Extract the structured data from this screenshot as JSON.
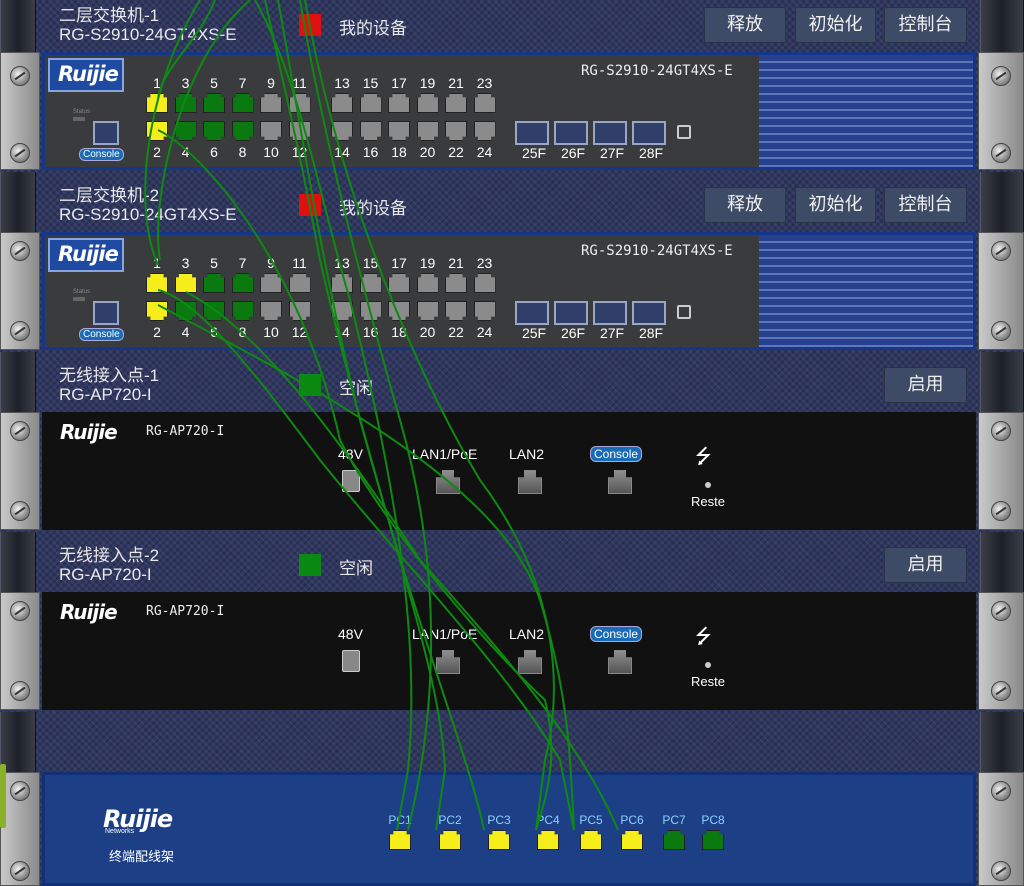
{
  "devices": [
    {
      "name": "二层交换机-1",
      "model": "RG-S2910-24GT4XS-E",
      "status_text": "我的设备",
      "status_color": "#e01010",
      "buttons": [
        "释放",
        "初始化",
        "控制台"
      ]
    },
    {
      "name": "二层交换机-2",
      "model": "RG-S2910-24GT4XS-E",
      "status_text": "我的设备",
      "status_color": "#e01010",
      "buttons": [
        "释放",
        "初始化",
        "控制台"
      ]
    },
    {
      "name": "无线接入点-1",
      "model": "RG-AP720-I",
      "status_text": "空闲",
      "status_color": "#0a8a12",
      "buttons": [
        "启用"
      ]
    },
    {
      "name": "无线接入点-2",
      "model": "RG-AP720-I",
      "status_text": "空闲",
      "status_color": "#0a8a12",
      "buttons": [
        "启用"
      ]
    }
  ],
  "switch_panel": {
    "logo": "Ruijie",
    "model_label": "RG-S2910-24GT4XS-E",
    "top_numbers": [
      "1",
      "3",
      "5",
      "7",
      "9",
      "11",
      "13",
      "15",
      "17",
      "19",
      "21",
      "23"
    ],
    "bottom_numbers": [
      "2",
      "4",
      "6",
      "8",
      "10",
      "12",
      "14",
      "16",
      "18",
      "20",
      "22",
      "24"
    ],
    "sfp_labels": [
      "25F",
      "26F",
      "27F",
      "28F"
    ],
    "console": "Console",
    "status_led": "Status",
    "port_colors": [
      {
        "top": [
          "yellow",
          "green",
          "green",
          "green",
          "gray",
          "gray",
          "gray",
          "gray",
          "gray",
          "gray",
          "gray",
          "gray"
        ],
        "bottom": [
          "yellow",
          "green",
          "green",
          "green",
          "gray",
          "gray",
          "gray",
          "gray",
          "gray",
          "gray",
          "gray",
          "gray"
        ]
      },
      {
        "top": [
          "yellow",
          "yellow",
          "green",
          "green",
          "gray",
          "gray",
          "gray",
          "gray",
          "gray",
          "gray",
          "gray",
          "gray"
        ],
        "bottom": [
          "yellow",
          "green",
          "green",
          "green",
          "gray",
          "gray",
          "gray",
          "gray",
          "gray",
          "gray",
          "gray",
          "gray"
        ]
      }
    ]
  },
  "ap_panel": {
    "logo": "Ruijie",
    "model_label": "RG-AP720-I",
    "labels": {
      "power": "48V",
      "lan1": "LAN1/PoE",
      "lan2": "LAN2",
      "console": "Console",
      "reset": "Reste"
    },
    "usb_icon": "usb-icon"
  },
  "patch_panel": {
    "logo": "Ruijie",
    "logo_sub": "Networks",
    "caption": "终端配线架",
    "ports": [
      {
        "label": "PC1",
        "color": "yellow"
      },
      {
        "label": "PC2",
        "color": "yellow"
      },
      {
        "label": "PC3",
        "color": "yellow"
      },
      {
        "label": "PC4",
        "color": "yellow"
      },
      {
        "label": "PC5",
        "color": "yellow"
      },
      {
        "label": "PC6",
        "color": "yellow"
      },
      {
        "label": "PC7",
        "color": "green"
      },
      {
        "label": "PC8",
        "color": "green"
      }
    ]
  },
  "colors": {
    "cable": "#0e8a12",
    "port_yellow": "#f5ee1a",
    "port_green": "#0a7a10",
    "port_gray": "#8b8b8b"
  }
}
